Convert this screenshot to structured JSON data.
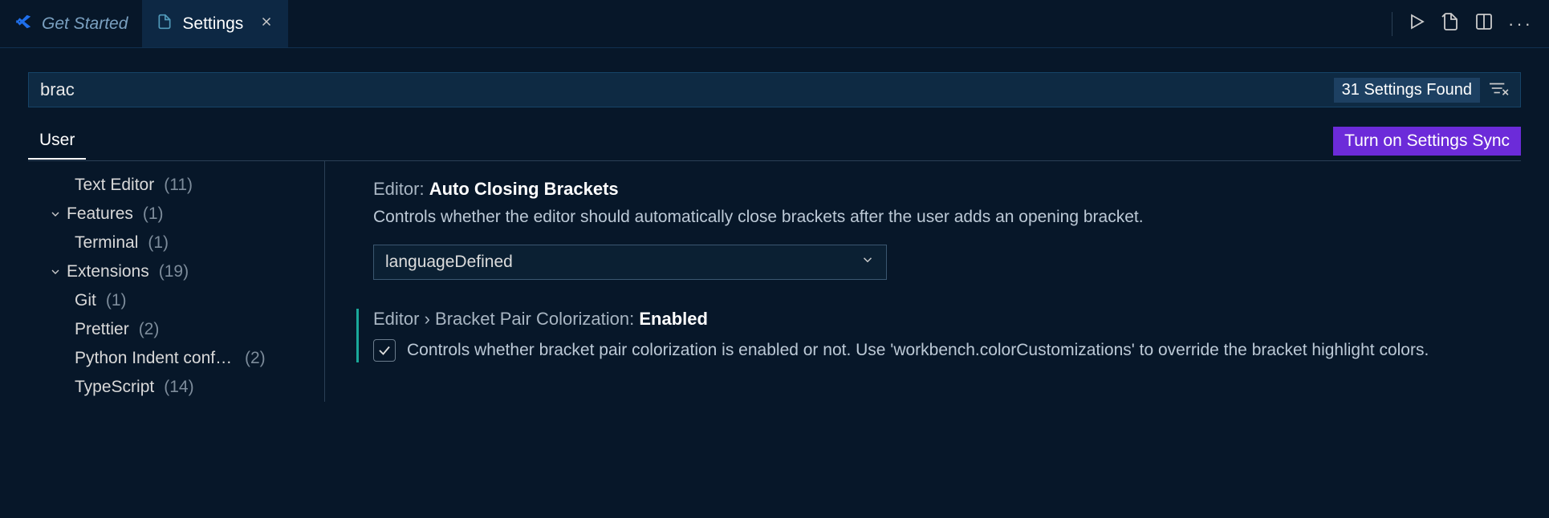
{
  "tabs": {
    "inactive": "Get Started",
    "active": "Settings"
  },
  "search": {
    "value": "brac",
    "found_label": "31 Settings Found"
  },
  "scope": {
    "user": "User",
    "sync": "Turn on Settings Sync"
  },
  "toc": {
    "textEditor": {
      "label": "Text Editor",
      "count": "(11)"
    },
    "features": {
      "label": "Features",
      "count": "(1)"
    },
    "terminal": {
      "label": "Terminal",
      "count": "(1)"
    },
    "extensions": {
      "label": "Extensions",
      "count": "(19)"
    },
    "git": {
      "label": "Git",
      "count": "(1)"
    },
    "prettier": {
      "label": "Prettier",
      "count": "(2)"
    },
    "python": {
      "label": "Python Indent configuration",
      "count": "(2)"
    },
    "typescript": {
      "label": "TypeScript",
      "count": "(14)"
    }
  },
  "settings": {
    "autoClosing": {
      "prefix": "Editor: ",
      "name": "Auto Closing Brackets",
      "desc": "Controls whether the editor should automatically close brackets after the user adds an opening bracket.",
      "value": "languageDefined"
    },
    "bracketPair": {
      "prefix": "Editor › Bracket Pair Colorization: ",
      "name": "Enabled",
      "desc": "Controls whether bracket pair colorization is enabled or not. Use 'workbench.colorCustomizations' to override the bracket highlight colors."
    }
  }
}
